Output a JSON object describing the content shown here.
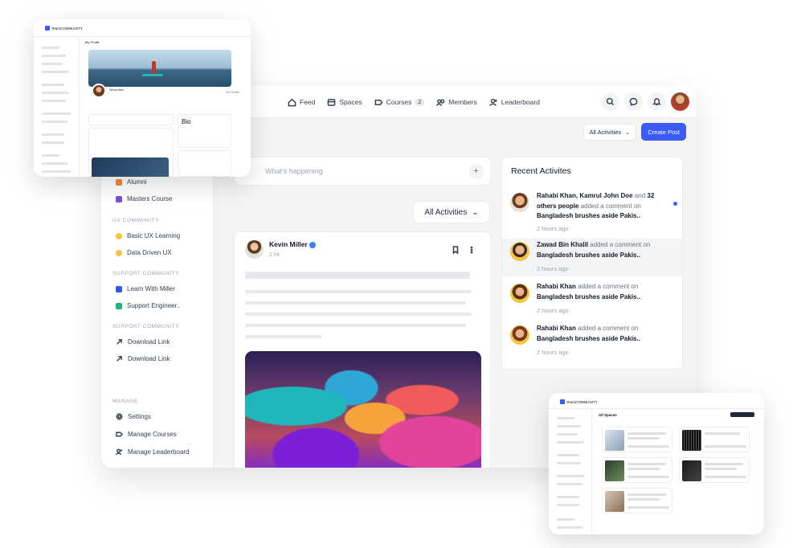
{
  "nav": {
    "items": [
      {
        "label": "Feed",
        "icon": "home-icon"
      },
      {
        "label": "Spaces",
        "icon": "spaces-icon"
      },
      {
        "label": "Courses",
        "icon": "courses-icon",
        "count": "2"
      },
      {
        "label": "Members",
        "icon": "members-icon"
      },
      {
        "label": "Leaderboard",
        "icon": "leaderboard-icon"
      }
    ]
  },
  "toolbar": {
    "filter_label": "All Activities",
    "create_label": "Create Post"
  },
  "composer": {
    "placeholder": "What's happening"
  },
  "feed_filter": {
    "label": "All Activities"
  },
  "sidebar": {
    "items_top": [
      {
        "label": "Alumni",
        "color": "#f0873c"
      },
      {
        "label": "Masters Course",
        "color": "#7c4ddb"
      }
    ],
    "ux_section": "UX COMMUNITY",
    "ux_items": [
      "Basic UX Learning",
      "Data Driven UX"
    ],
    "support_section": "SUPPORT COMMUNITY",
    "support_items": [
      {
        "label": "Learn With Miller",
        "color": "#2f5bea"
      },
      {
        "label": "Support Engineer..",
        "color": "#22b573"
      }
    ],
    "support_section_2": "SUPPORT COMMUNITY",
    "download_items": [
      "Download Link",
      "Download Link"
    ],
    "manage_section": "MANAGE",
    "manage_items": [
      "Settings",
      "Manage Courses",
      "Manage Leaderboard"
    ]
  },
  "post": {
    "author": "Kevin Miller",
    "time": "2 Hr"
  },
  "recent": {
    "title": "Recent Activites",
    "items": [
      {
        "actor": "Rahabi Khan, Kamrul John Doe",
        "mid": " and ",
        "extra": "32 others people",
        "action": " added a comment on ",
        "target": "Bangladesh brushes aside Pakis..",
        "time": "2 hours ago",
        "unread": true
      },
      {
        "actor": "Zawad Bin Khalil",
        "mid": "",
        "extra": "",
        "action": " added a comment on ",
        "target": "Bangladesh brushes aside Pakis..",
        "time": "2 hours ago",
        "unread": false
      },
      {
        "actor": "Rahabi Khan",
        "mid": "",
        "extra": "",
        "action": " added a comment on ",
        "target": "Bangladesh brushes aside Pakis..",
        "time": "2 hours ago",
        "unread": false
      },
      {
        "actor": "Rahabi Khan",
        "mid": "",
        "extra": "",
        "action": " added a comment on ",
        "target": "Bangladesh brushes aside Pakis..",
        "time": "2 hours ago",
        "unread": false
      }
    ]
  },
  "mini1": {
    "logo": "TeamCOMMUNITY",
    "page_title": "My Profile",
    "edit_label": "Edit Profile",
    "name": "Sirine Alex",
    "bio_title": "Bio"
  },
  "mini2": {
    "logo": "TeamCOMMUNITY",
    "title": "All Spaces"
  },
  "colors": {
    "accent": "#3b5bfd",
    "background": "#f3f4f6"
  }
}
